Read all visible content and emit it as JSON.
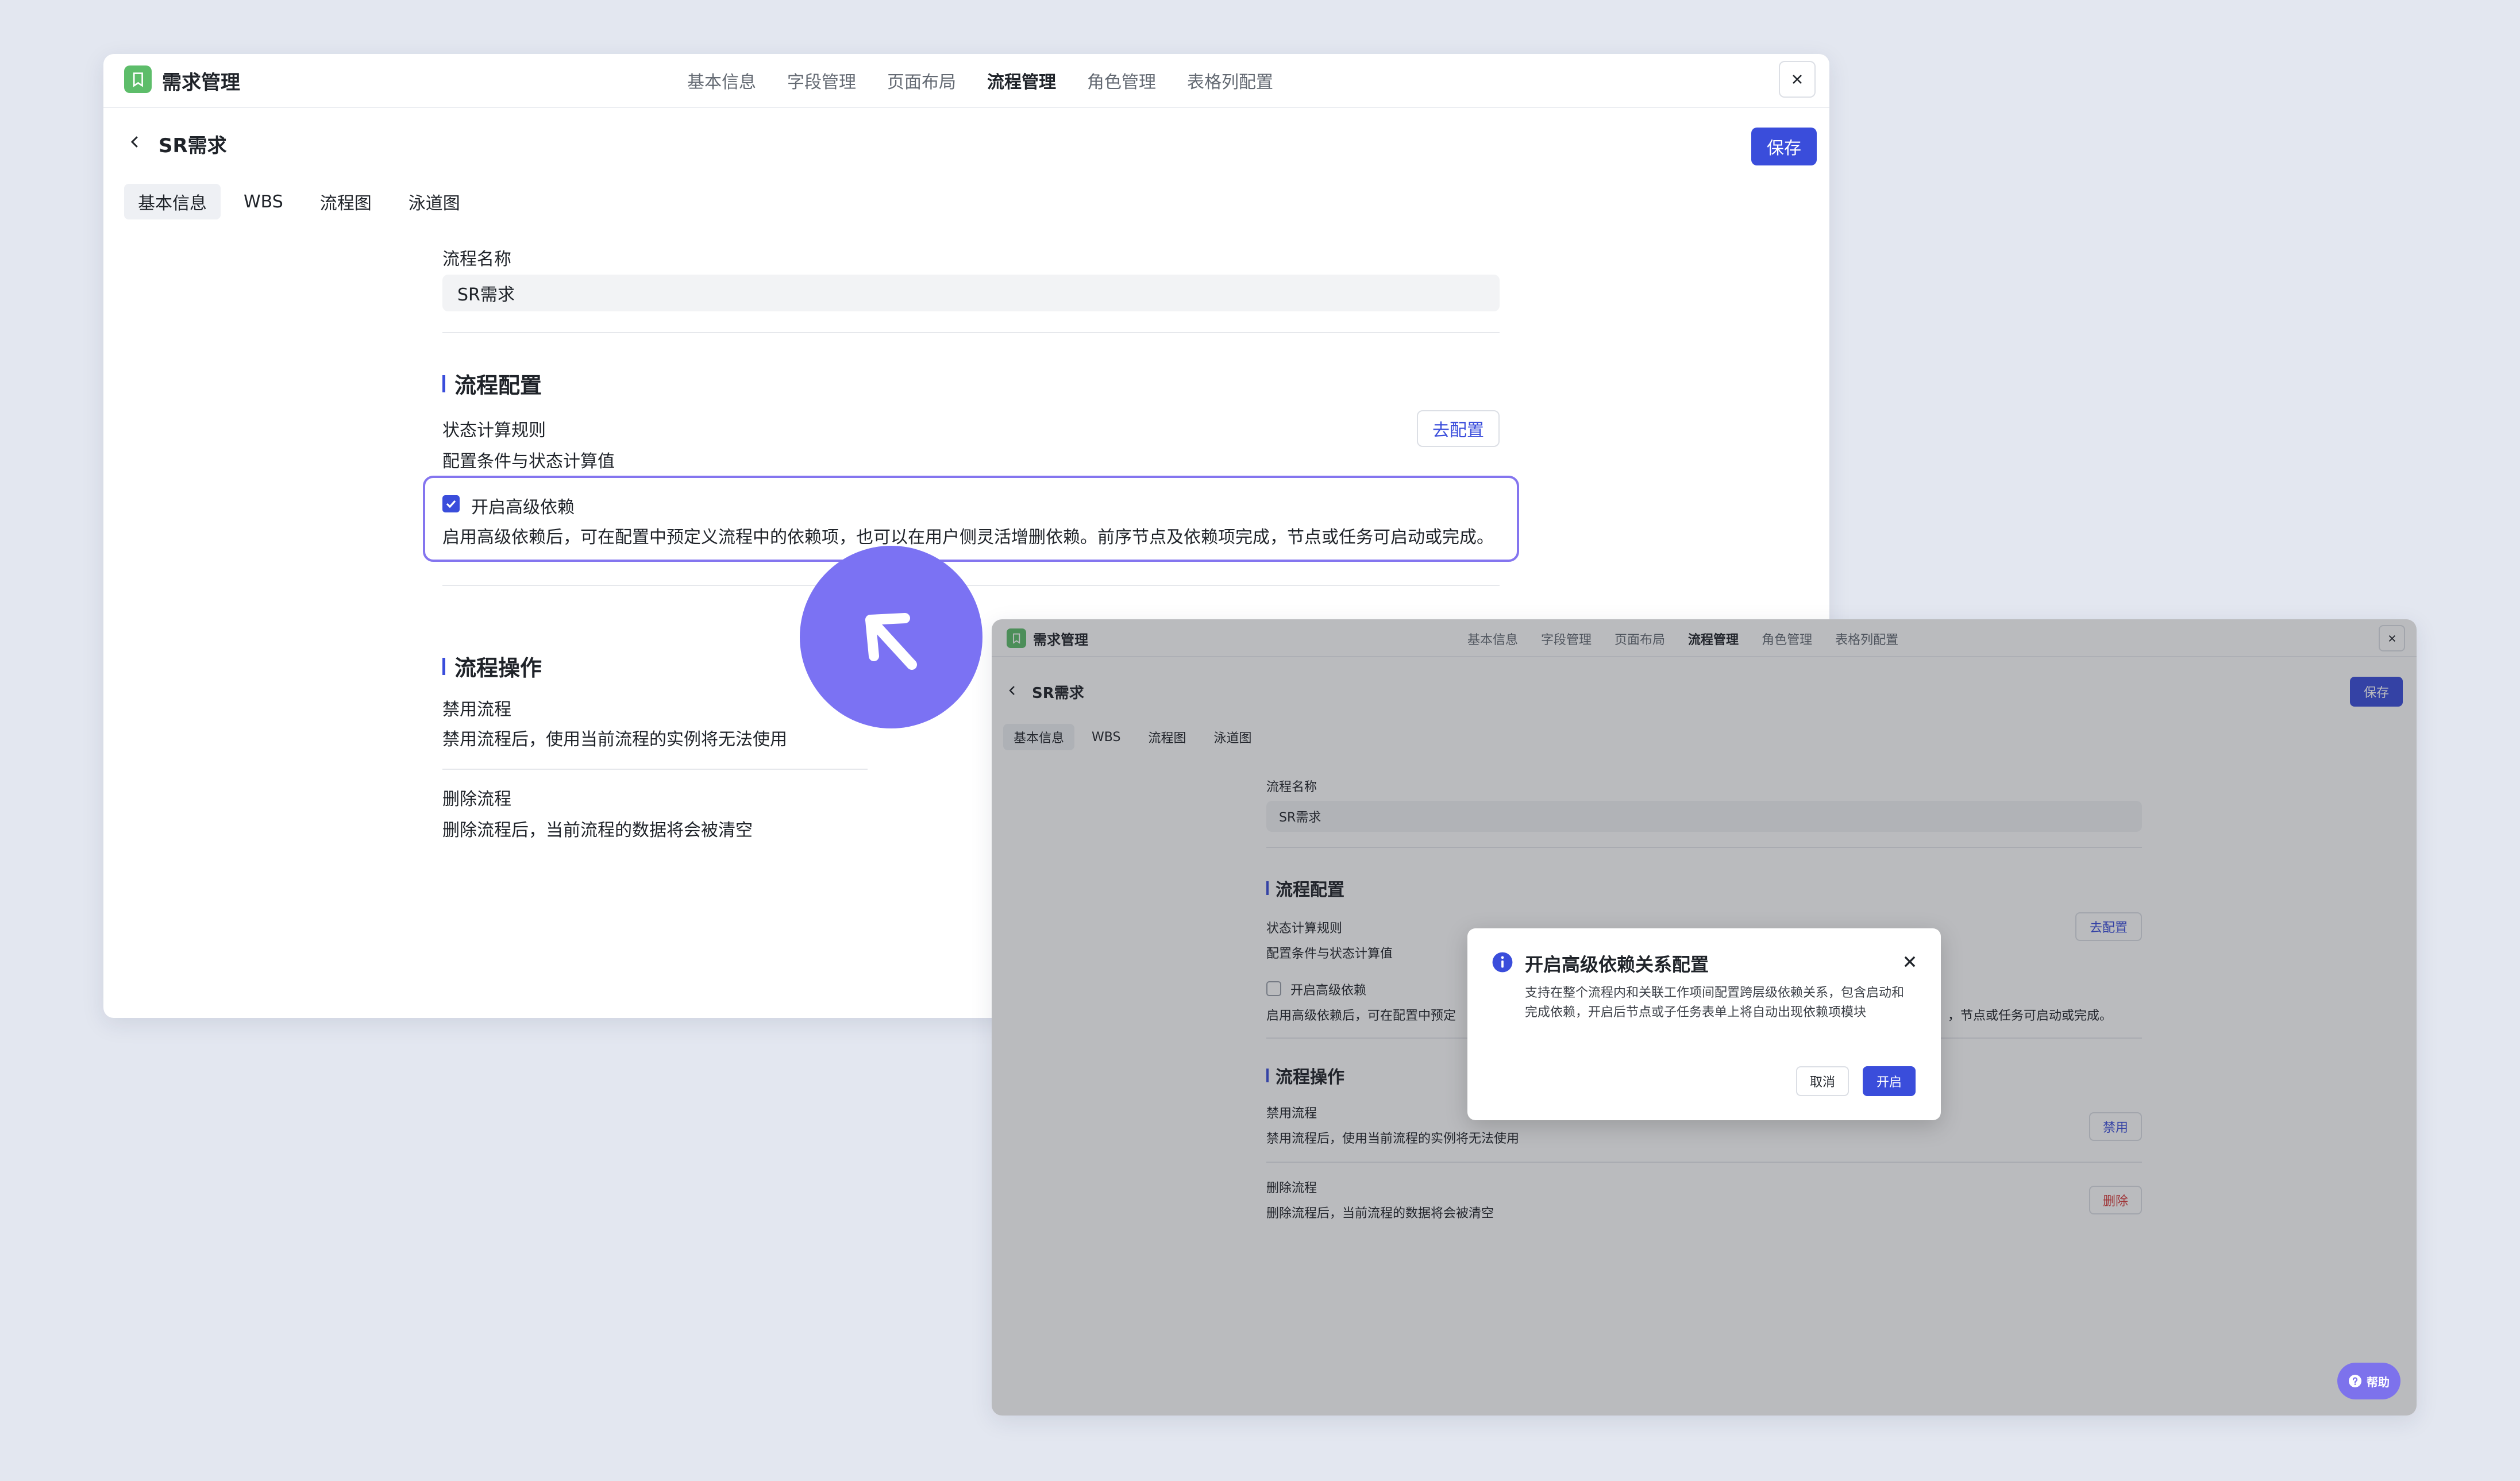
{
  "app": {
    "title": "需求管理"
  },
  "nav": [
    "基本信息",
    "字段管理",
    "页面布局",
    "流程管理",
    "角色管理",
    "表格列配置"
  ],
  "page": {
    "title": "SR需求",
    "save_label": "保存"
  },
  "subtabs": [
    "基本信息",
    "WBS",
    "流程图",
    "泳道图"
  ],
  "form": {
    "flow_name_label": "流程名称",
    "flow_name_value": "SR需求"
  },
  "flow_config": {
    "title": "流程配置",
    "status_rule_label": "状态计算规则",
    "status_rule_desc": "配置条件与状态计算值",
    "config_button": "去配置",
    "advanced_dep_label": "开启高级依赖",
    "advanced_dep_desc": "启用高级依赖后，可在配置中预定义流程中的依赖项，也可以在用户侧灵活增删依赖。前序节点及依赖项完成，节点或任务可启动或完成。"
  },
  "flow_ops": {
    "title": "流程操作",
    "disable_label": "禁用流程",
    "disable_desc": "禁用流程后，使用当前流程的实例将无法使用",
    "disable_button": "禁用",
    "delete_label": "删除流程",
    "delete_desc": "删除流程后，当前流程的数据将会被清空",
    "delete_button": "删除"
  },
  "dialog": {
    "title": "开启高级依赖关系配置",
    "body": "支持在整个流程内和关联工作项间配置跨层级依赖关系，包含启动和完成依赖，开启后节点或子任务表单上将自动出现依赖项模块",
    "cancel_label": "取消",
    "ok_label": "开启"
  },
  "background_snippet": {
    "desc_left": "启用高级依赖后，可在配置中预定",
    "desc_right": "，节点或任务可启动或完成。"
  },
  "help": {
    "label": "帮助"
  },
  "colors": {
    "accent": "#3a4ddb",
    "highlight": "#8475ef",
    "cursor": "#7b72f3",
    "logo": "#5dbd6a",
    "danger": "#d83b3b"
  }
}
